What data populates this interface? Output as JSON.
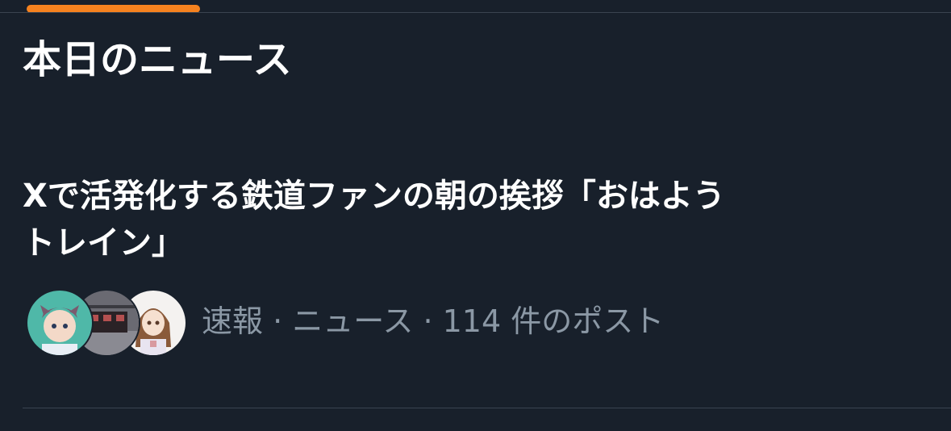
{
  "section": {
    "title": "本日のニュース"
  },
  "news_item": {
    "headline_line1": "Xで活発化する鉄道ファンの朝の挨拶「おはよう",
    "headline_line2": "トレイン」",
    "category": "速報",
    "subcategory": "ニュース",
    "post_count": "114 件のポスト",
    "separator": " · ",
    "avatars": [
      "avatar-anime-character",
      "avatar-train-photo",
      "avatar-anime-girl"
    ]
  },
  "colors": {
    "background": "#18202b",
    "accent": "#f5821f",
    "meta_text": "#8b98a5",
    "divider": "#3a4450"
  }
}
